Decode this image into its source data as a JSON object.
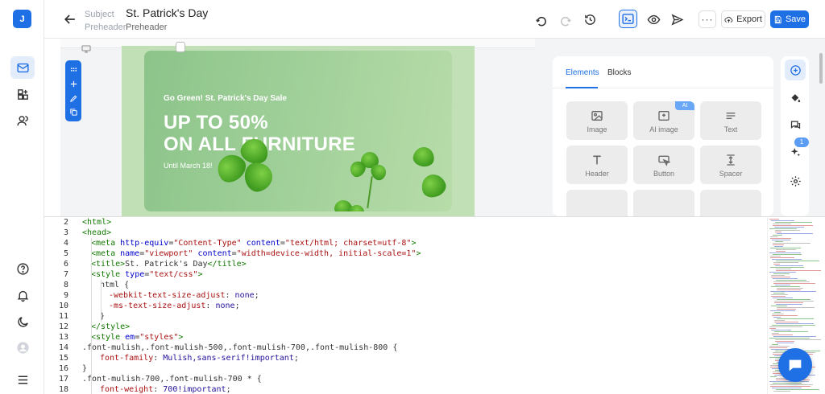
{
  "app": {
    "logo_letter": "J"
  },
  "header": {
    "subject_label": "Subject",
    "preheader_label": "Preheader",
    "subject_value": "St. Patrick's Day",
    "preheader_value": "Preheader",
    "more_label": "···",
    "export_label": "Export",
    "save_label": "Save"
  },
  "email": {
    "eyebrow": "Go Green! St. Patrick's Day Sale",
    "headline_1": "UP TO 50%",
    "headline_2": "ON ALL FURNITURE",
    "until": "Until March 18!"
  },
  "panel": {
    "tabs": [
      "Elements",
      "Blocks"
    ],
    "elements": [
      {
        "label": "Image",
        "icon": "image-icon"
      },
      {
        "label": "AI image",
        "icon": "ai-image-icon",
        "badge": "AI"
      },
      {
        "label": "Text",
        "icon": "text-icon"
      },
      {
        "label": "Header",
        "icon": "header-icon"
      },
      {
        "label": "Button",
        "icon": "button-icon"
      },
      {
        "label": "Spacer",
        "icon": "spacer-icon"
      }
    ],
    "tools_badge": "1"
  },
  "code": {
    "lines": [
      {
        "n": "2",
        "indent": 0,
        "parts": [
          [
            "t-tag",
            "<html>"
          ]
        ]
      },
      {
        "n": "3",
        "indent": 0,
        "parts": [
          [
            "t-tag",
            "<head>"
          ]
        ]
      },
      {
        "n": "4",
        "indent": 1,
        "parts": [
          [
            "t-tag",
            "<meta "
          ],
          [
            "t-attr",
            "http-equiv"
          ],
          [
            "t-plain",
            "="
          ],
          [
            "t-str",
            "\"Content-Type\""
          ],
          [
            "t-plain",
            " "
          ],
          [
            "t-attr",
            "content"
          ],
          [
            "t-plain",
            "="
          ],
          [
            "t-str",
            "\"text/html; charset=utf-8\""
          ],
          [
            "t-tag",
            ">"
          ]
        ]
      },
      {
        "n": "5",
        "indent": 1,
        "parts": [
          [
            "t-tag",
            "<meta "
          ],
          [
            "t-attr",
            "name"
          ],
          [
            "t-plain",
            "="
          ],
          [
            "t-str",
            "\"viewport\""
          ],
          [
            "t-plain",
            " "
          ],
          [
            "t-attr",
            "content"
          ],
          [
            "t-plain",
            "="
          ],
          [
            "t-str",
            "\"width=device-width, initial-scale=1\""
          ],
          [
            "t-tag",
            ">"
          ]
        ]
      },
      {
        "n": "6",
        "indent": 1,
        "parts": [
          [
            "t-tag",
            "<title>"
          ],
          [
            "t-plain",
            "St. Patrick's Day"
          ],
          [
            "t-tag",
            "</title>"
          ]
        ]
      },
      {
        "n": "7",
        "indent": 1,
        "parts": [
          [
            "t-tag",
            "<style "
          ],
          [
            "t-attr",
            "type"
          ],
          [
            "t-plain",
            "="
          ],
          [
            "t-str",
            "\"text/css\""
          ],
          [
            "t-tag",
            ">"
          ]
        ]
      },
      {
        "n": "8",
        "indent": 2,
        "parts": [
          [
            "t-plain",
            "html {"
          ]
        ]
      },
      {
        "n": "9",
        "indent": 3,
        "parts": [
          [
            "t-prop",
            "-webkit-text-size-adjust"
          ],
          [
            "t-plain",
            ": "
          ],
          [
            "t-val",
            "none"
          ],
          [
            "t-plain",
            ";"
          ]
        ]
      },
      {
        "n": "10",
        "indent": 3,
        "parts": [
          [
            "t-prop",
            "-ms-text-size-adjust"
          ],
          [
            "t-plain",
            ": "
          ],
          [
            "t-val",
            "none"
          ],
          [
            "t-plain",
            ";"
          ]
        ]
      },
      {
        "n": "11",
        "indent": 2,
        "parts": [
          [
            "t-plain",
            "}"
          ]
        ]
      },
      {
        "n": "12",
        "indent": 1,
        "parts": [
          [
            "t-tag",
            "</style>"
          ]
        ]
      },
      {
        "n": "13",
        "indent": 1,
        "parts": [
          [
            "t-tag",
            "<style "
          ],
          [
            "t-attr",
            "em"
          ],
          [
            "t-plain",
            "="
          ],
          [
            "t-str",
            "\"styles\""
          ],
          [
            "t-tag",
            ">"
          ]
        ]
      },
      {
        "n": "14",
        "indent": 0,
        "parts": [
          [
            "t-plain",
            ".font-mulish,.font-mulish-500,.font-mulish-700,.font-mulish-800 {"
          ]
        ]
      },
      {
        "n": "15",
        "indent": 2,
        "parts": [
          [
            "t-prop",
            "font-family"
          ],
          [
            "t-plain",
            ": "
          ],
          [
            "t-val",
            "Mulish,sans-serif!important"
          ],
          [
            "t-plain",
            ";"
          ]
        ]
      },
      {
        "n": "16",
        "indent": 0,
        "parts": [
          [
            "t-plain",
            "}"
          ]
        ]
      },
      {
        "n": "17",
        "indent": 0,
        "parts": [
          [
            "t-plain",
            ".font-mulish-700,.font-mulish-700 * {"
          ]
        ]
      },
      {
        "n": "18",
        "indent": 2,
        "parts": [
          [
            "t-prop",
            "font-weight"
          ],
          [
            "t-plain",
            ": "
          ],
          [
            "t-val",
            "700!important"
          ],
          [
            "t-plain",
            ";"
          ]
        ]
      }
    ]
  },
  "colors": {
    "accent": "#1f6fe5",
    "hero_green": "#9fcf98"
  }
}
